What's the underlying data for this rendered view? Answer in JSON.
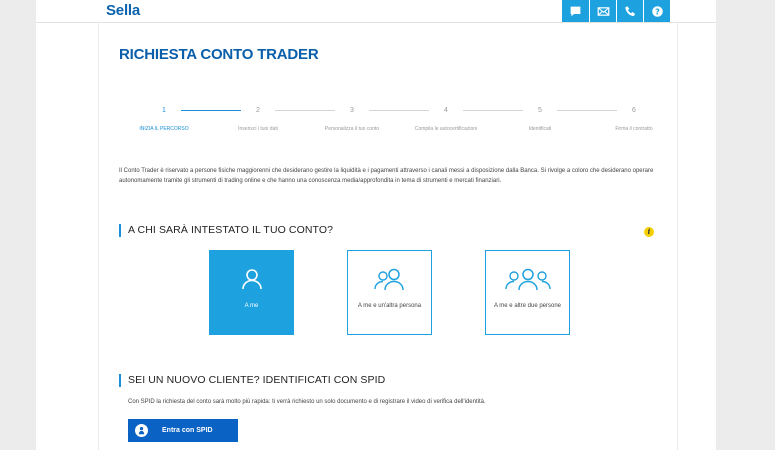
{
  "header": {
    "logo": "Sella",
    "icons": [
      "chat-icon",
      "mail-icon",
      "phone-icon",
      "help-icon"
    ]
  },
  "page_title": "RICHIESTA CONTO TRADER",
  "stepper": {
    "active_index": 0,
    "steps": [
      {
        "number": "1",
        "label": "INIZIA IL PERCORSO"
      },
      {
        "number": "2",
        "label": "Inserisci i tuoi dati"
      },
      {
        "number": "3",
        "label": "Personalizza il tuo conto"
      },
      {
        "number": "4",
        "label": "Compila le autocertificazioni"
      },
      {
        "number": "5",
        "label": "Identificati"
      },
      {
        "number": "6",
        "label": "Firma il contratto"
      }
    ]
  },
  "intro_text": "Il Conto Trader è riservato a persone fisiche maggiorenni che desiderano gestire la liquidità e i pagamenti attraverso i canali messi a disposizione dalla Banca. Si rivolge a coloro che desiderano operare autonomamente tramite gli strumenti di trading online e che hanno una conoscenza media/approfondita in tema di strumenti e mercati finanziari.",
  "owner_section": {
    "title": "A CHI SARÀ INTESTATO IL TUO CONTO?",
    "info_icon": "i",
    "options": [
      {
        "label": "A me",
        "selected": true
      },
      {
        "label": "A me e un'altra persona",
        "selected": false
      },
      {
        "label": "A me e altre due persone",
        "selected": false
      }
    ]
  },
  "spid_section": {
    "title": "SEI UN NUOVO CLIENTE? IDENTIFICATI CON SPID",
    "text": "Con SPID la richiesta del conto sarà molto più rapida: ti verrà richiesto un solo documento e di registrare il video di verifica dell'identità.",
    "button_label": "Entra con SPID"
  },
  "colors": {
    "brand_blue": "#0a62ae",
    "accent": "#1ea1df",
    "spid_blue": "#0a62c4",
    "info_yellow": "#f3d100"
  }
}
